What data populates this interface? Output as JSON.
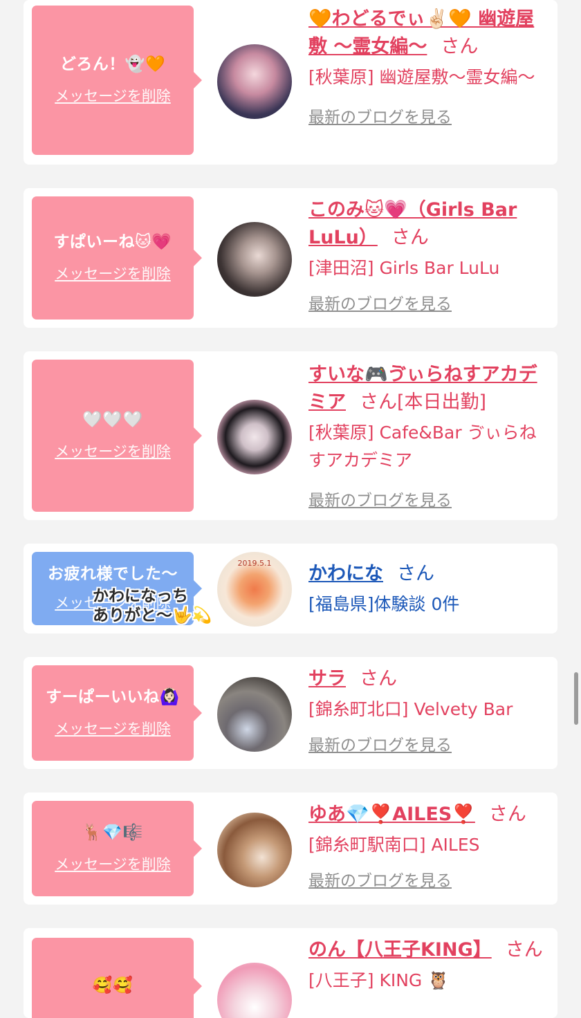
{
  "cards": [
    {
      "bubble_text": "どろん！👻🧡",
      "delete_label": "メッセージを削除",
      "name": "🧡わどるでぃ✌🏻🧡 幽遊屋敷 〜霊女編〜",
      "san": "さん",
      "shop": "[秋葉原] 幽遊屋敷〜霊女編〜",
      "blog_label": "最新のブログを見る"
    },
    {
      "bubble_text": "すぱいーね🐱💗",
      "delete_label": "メッセージを削除",
      "name": "このみ🐱💗（Girls Bar LuLu）",
      "san": "さん",
      "shop": "[津田沼] Girls Bar LuLu",
      "blog_label": "最新のブログを見る"
    },
    {
      "bubble_text": "🤍🤍🤍",
      "delete_label": "メッセージを削除",
      "name": "すいな🎮ゔぃらねすアカデミア",
      "san": "さん",
      "status": "[本日出勤]",
      "shop": "[秋葉原] Cafe&Bar ゔぃらねすアカデミア",
      "blog_label": "最新のブログを見る"
    },
    {
      "bubble_text": "お疲れ様でした〜",
      "delete_label": "メッセージを削除",
      "name": "かわにな",
      "san": "さん",
      "shop": "[福島県]体験談 0件",
      "overlay_line1": "かわになっち",
      "overlay_line2": "ありがと〜🤟💫",
      "avatar_plate_text": "2019.5.1"
    },
    {
      "bubble_text": "すーぱーいいね🙆🏻‍♀️",
      "delete_label": "メッセージを削除",
      "name": "サラ",
      "san": "さん",
      "shop": "[錦糸町北口] Velvety Bar",
      "blog_label": "最新のブログを見る"
    },
    {
      "bubble_text": "🦌💎🎼",
      "delete_label": "メッセージを削除",
      "name": "ゆあ💎❣️AILES❣️",
      "san": "さん",
      "shop": "[錦糸町駅南口] AILES",
      "blog_label": "最新のブログを見る"
    },
    {
      "bubble_text": "🥰🥰",
      "name": "のん【八王子KING】",
      "san": "さん",
      "shop": "[八王子] KING 🦉"
    }
  ],
  "colors": {
    "bubble_pink": "#fb95a4",
    "bubble_blue": "#7fabf1",
    "name_pink": "#e2415f",
    "name_blue": "#1c58b8",
    "link_gray": "#8f8f8f"
  }
}
